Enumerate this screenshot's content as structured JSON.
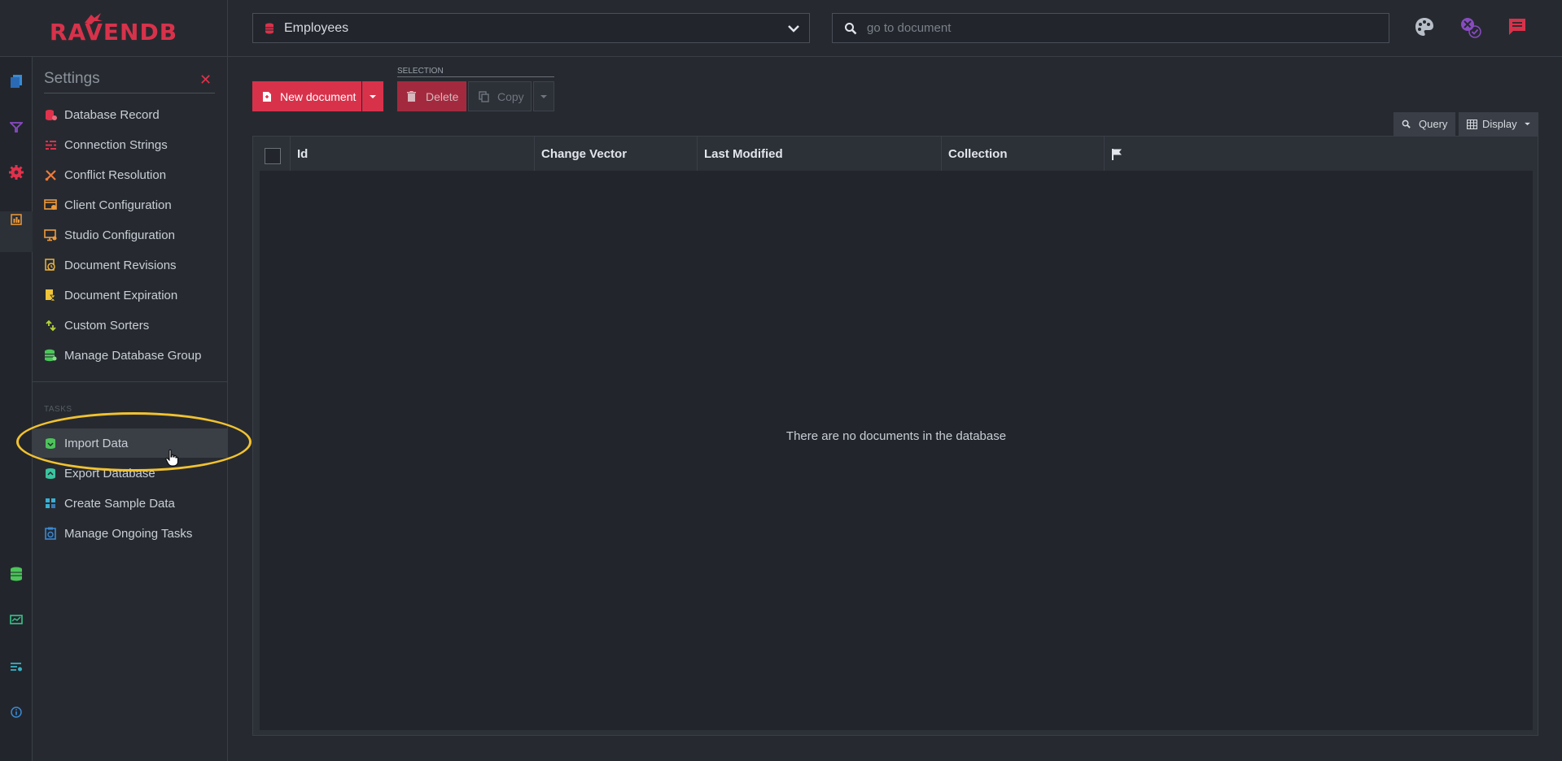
{
  "app": {
    "logo_text": "RAVENDB"
  },
  "topbar": {
    "database": "Employees",
    "search_placeholder": "go to document",
    "icons": [
      "palette-icon",
      "notification-status-icon",
      "chat-icon"
    ]
  },
  "rail": {
    "icons": [
      "documents-icon",
      "indexes-icon",
      "settings-icon",
      "stats-icon",
      "databases-icon",
      "cluster-icon",
      "server-settings-icon",
      "about-icon"
    ]
  },
  "settings": {
    "title": "Settings",
    "close": "✕",
    "items": [
      {
        "label": "Database Record",
        "icon": "database-record-icon",
        "color": "#e0324c"
      },
      {
        "label": "Connection Strings",
        "icon": "connection-strings-icon",
        "color": "#e0324c"
      },
      {
        "label": "Conflict Resolution",
        "icon": "conflict-icon",
        "color": "#ef7a3a"
      },
      {
        "label": "Client Configuration",
        "icon": "client-config-icon",
        "color": "#ef9a3a"
      },
      {
        "label": "Studio Configuration",
        "icon": "studio-config-icon",
        "color": "#ef9a3a"
      },
      {
        "label": "Document Revisions",
        "icon": "revisions-icon",
        "color": "#efb43a"
      },
      {
        "label": "Document Expiration",
        "icon": "expiration-icon",
        "color": "#efc43a"
      },
      {
        "label": "Custom Sorters",
        "icon": "sorters-icon",
        "color": "#b6d43a"
      },
      {
        "label": "Manage Database Group",
        "icon": "db-group-icon",
        "color": "#4cc45a"
      }
    ],
    "tasks_label": "TASKS",
    "tasks": [
      {
        "label": "Import Data",
        "icon": "import-icon",
        "color": "#4cc45a"
      },
      {
        "label": "Export Database",
        "icon": "export-icon",
        "color": "#3ac4a0"
      },
      {
        "label": "Create Sample Data",
        "icon": "sample-data-icon",
        "color": "#3ab0d4"
      },
      {
        "label": "Manage Ongoing Tasks",
        "icon": "ongoing-tasks-icon",
        "color": "#3a8ad4"
      }
    ]
  },
  "toolbar": {
    "new_document": "New document",
    "selection_label": "SELECTION",
    "delete": "Delete",
    "copy": "Copy",
    "query": "Query",
    "display": "Display"
  },
  "grid": {
    "columns": [
      "Id",
      "Change Vector",
      "Last Modified",
      "Collection"
    ],
    "empty_message": "There are no documents in the database"
  },
  "colors": {
    "accent": "#d8324b",
    "highlight": "#f2c230"
  }
}
